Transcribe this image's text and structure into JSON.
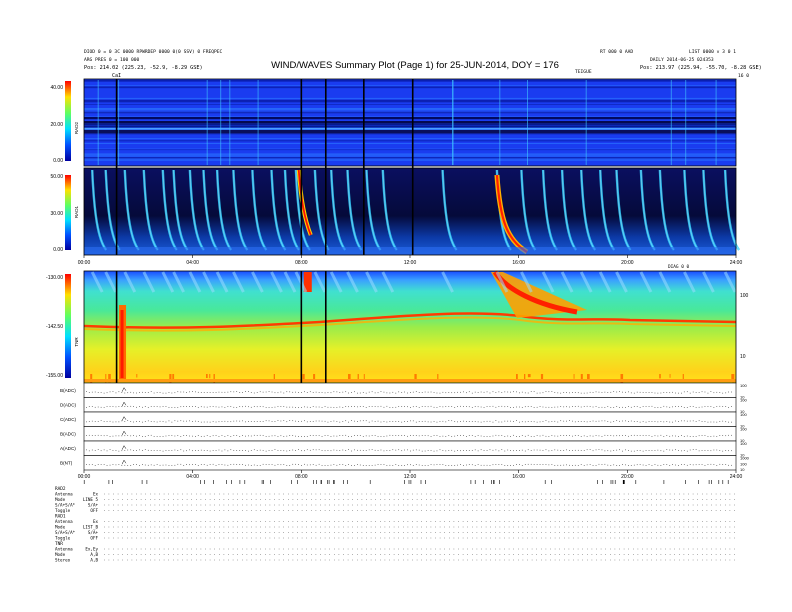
{
  "header": {
    "title": "WIND/WAVES Summary Plot (Page 1) for 25-JUN-2014, DOY = 176",
    "left_lines": [
      "DIOD 0 = 0 3C 0000 RPWRDEP 0000 0(0 SSV) 0 FREQPEC",
      "ARG PRES 0 = 100 000",
      "Pos:    214.02 (225.23, -52.9, -8.29 GSE)"
    ],
    "right_lines": [
      "RT 000 0 AAD",
      "DAILY 2014-06-25 024353",
      "Pos:    213.97 (225.94, -55.70, -8.28 GSE)"
    ],
    "mid_right_label": "TEIGUE",
    "right_top_label": "LIST 0000 v 3 0 1",
    "left_marker": "CaI",
    "right_marker": "16 0"
  },
  "rad2": {
    "label": "RAD2",
    "ticks": [
      "40.00",
      "20.00",
      "0.00"
    ]
  },
  "rad1": {
    "label": "RAD1",
    "ticks": [
      "50.00",
      "30.00",
      "0.00"
    ]
  },
  "tnr": {
    "label": "TNR",
    "ticks": [
      "-130.00",
      "-142.50",
      "-155.00"
    ],
    "right_ticks": [
      "100",
      "10"
    ],
    "right_label": "DIAG 0 0"
  },
  "time_axis": {
    "ticks": [
      "00:00",
      "04:00",
      "08:00",
      "12:00",
      "16:00",
      "20:00",
      "24:00"
    ]
  },
  "line_panels": [
    {
      "label": "B(ADC)",
      "right_ticks": [
        "100",
        "10"
      ]
    },
    {
      "label": "D(ADC)",
      "right_ticks": [
        "100",
        "10"
      ]
    },
    {
      "label": "C(ADC)",
      "right_ticks": [
        "100",
        "10"
      ]
    },
    {
      "label": "B(ADC)",
      "right_ticks": [
        "100",
        "10"
      ]
    },
    {
      "label": "A(ADC)",
      "right_ticks": [
        "100",
        "10"
      ]
    },
    {
      "label": "B(NT)",
      "right_ticks": [
        "1000",
        "100",
        "10"
      ]
    }
  ],
  "status": {
    "groups": [
      {
        "name": "RAD2",
        "rows": [
          [
            "Antenna",
            "Ex"
          ],
          [
            "Mode",
            "LINE 5"
          ],
          [
            "S/A+S/A* ",
            "S/A+"
          ],
          [
            "Toggle",
            "OFF"
          ]
        ]
      },
      {
        "name": "RAD1",
        "rows": [
          [
            "Antenna",
            "Ex"
          ],
          [
            "Mode",
            "LIST_B"
          ],
          [
            "S/A+S/A* ",
            "S/A+"
          ],
          [
            "Toggle",
            "OFF"
          ]
        ]
      },
      {
        "name": "TNR",
        "rows": [
          [
            "Antenna",
            "Ex,Ey"
          ],
          [
            "Mode",
            "A,B"
          ],
          [
            "Stereo",
            "A,B"
          ]
        ]
      }
    ]
  },
  "chart_data": {
    "type": "heatmap",
    "title": "WIND/WAVES Summary Plot (Page 1) for 25-JUN-2014, DOY = 176",
    "x": [
      "00:00",
      "04:00",
      "08:00",
      "12:00",
      "16:00",
      "20:00",
      "24:00"
    ],
    "xlim": [
      0,
      24
    ],
    "panels": [
      {
        "name": "RAD2",
        "ylim": [
          0,
          40
        ]
      },
      {
        "name": "RAD1",
        "ylim": [
          0,
          50
        ]
      },
      {
        "name": "TNR",
        "ylim": [
          -155,
          -130
        ]
      }
    ],
    "events_hours": [
      1.4,
      4.9,
      6.9,
      8.2,
      10.4,
      15.2,
      23.6
    ],
    "data_gaps_hours": [
      1.2,
      8.0,
      8.9,
      10.3,
      12.1
    ]
  }
}
